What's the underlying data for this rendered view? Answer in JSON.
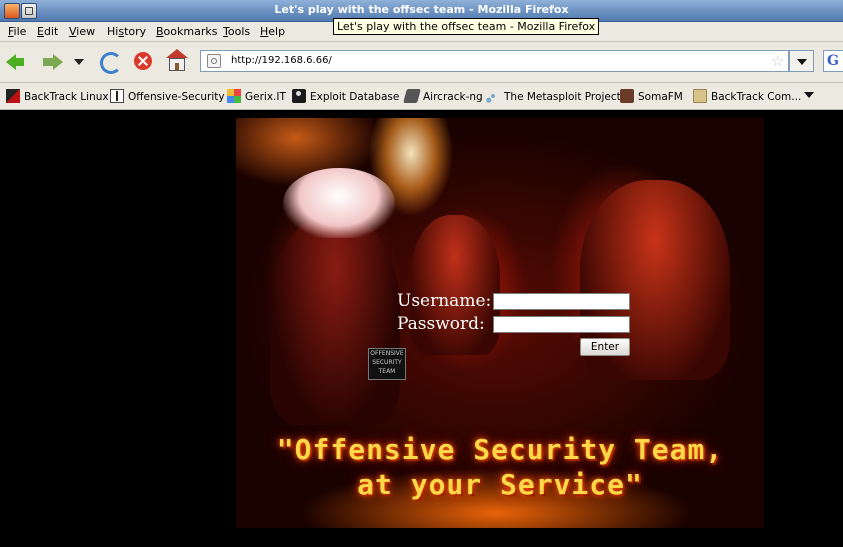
{
  "window": {
    "title": "Let's play with the offsec team - Mozilla Firefox",
    "tooltip": "Let's play with the offsec team - Mozilla Firefox"
  },
  "menu": {
    "items": [
      {
        "label": "File",
        "underline": "F",
        "rest": "ile"
      },
      {
        "label": "Edit",
        "underline": "E",
        "rest": "dit"
      },
      {
        "label": "View",
        "underline": "V",
        "rest": "iew"
      },
      {
        "label": "History",
        "prefix": "Hi",
        "underline": "s",
        "rest": "tory"
      },
      {
        "label": "Bookmarks",
        "underline": "B",
        "rest": "ookmarks"
      },
      {
        "label": "Tools",
        "underline": "T",
        "rest": "ools"
      },
      {
        "label": "Help",
        "underline": "H",
        "rest": "elp"
      }
    ]
  },
  "nav": {
    "url": "http://192.168.6.66/",
    "icons": [
      "back-icon",
      "forward-icon",
      "history-dropdown-icon",
      "reload-icon",
      "stop-icon",
      "home-icon"
    ],
    "search_engine_icon": "G"
  },
  "bookmarks": {
    "items": [
      {
        "label": "BackTrack Linux",
        "icon": "backtrack-icon"
      },
      {
        "label": "Offensive-Security",
        "icon": "offsec-icon"
      },
      {
        "label": "Gerix.IT",
        "icon": "gerix-icon"
      },
      {
        "label": "Exploit Database",
        "icon": "exploit-db-icon"
      },
      {
        "label": "Aircrack-ng",
        "icon": "aircrack-icon"
      },
      {
        "label": "The Metasploit Project",
        "icon": "metasploit-icon"
      },
      {
        "label": "SomaFM",
        "icon": "somafm-icon"
      },
      {
        "label": "BackTrack Com...",
        "icon": "folder-icon"
      }
    ]
  },
  "page": {
    "username_label": "Username:",
    "password_label": "Password:",
    "username_value": "",
    "password_value": "",
    "enter_label": "Enter",
    "slogan_line1": "\"Offensive Security Team,",
    "slogan_line2": "at your Service\"",
    "shirt_text": "OFFENSIVE SECURITY TEAM"
  },
  "colors": {
    "titlebar": "#4f79b0",
    "chrome": "#ece9e1",
    "content_bg": "#000000",
    "slogan": "#ffd84a"
  }
}
